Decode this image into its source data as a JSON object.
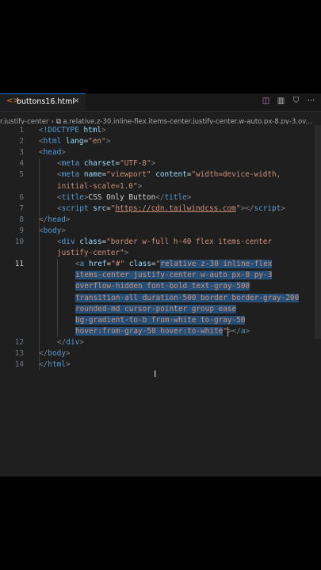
{
  "tab": {
    "icon": "code-icon",
    "name": "buttons16.html",
    "close": "×"
  },
  "breadcrumb": {
    "parent": "r.justify-center",
    "current": "a.relative.z-30.inline-flex.items-center.justify-center.w-auto.px-8.py-3.ov..."
  },
  "actions": [
    "split-compare-icon",
    "preview-icon",
    "lock-icon",
    "more-icon"
  ],
  "lines": [
    {
      "n": "1",
      "html": "<span class='br'>&lt;</span><span class='dt'>!DOCTYPE</span> <span class='at'>html</span><span class='br'>&gt;</span>",
      "indent": 0
    },
    {
      "n": "2",
      "html": "<span class='br'>&lt;</span><span class='tg'>html</span> <span class='at'>lang</span><span class='tx'>=</span><span class='st'>\"en\"</span><span class='br'>&gt;</span>",
      "indent": 0
    },
    {
      "n": "3",
      "html": "<span class='br'>&lt;</span><span class='tg'>head</span><span class='br'>&gt;</span>",
      "indent": 0
    },
    {
      "n": "4",
      "html": "<span class='br'>&lt;</span><span class='tg'>meta</span> <span class='at'>charset</span><span class='tx'>=</span><span class='st'>\"UTF-8\"</span><span class='br'>&gt;</span>",
      "indent": 1
    },
    {
      "n": "5",
      "html": "<span class='br'>&lt;</span><span class='tg'>meta</span> <span class='at'>name</span><span class='tx'>=</span><span class='st'>\"viewport\"</span> <span class='at'>content</span><span class='tx'>=</span><span class='st'>\"width=device-width,</span>",
      "indent": 1
    },
    {
      "n": "",
      "html": "<span class='st'>initial-scale=1.0\"</span><span class='br'>&gt;</span>",
      "indent": 1
    },
    {
      "n": "6",
      "html": "<span class='br'>&lt;</span><span class='tg'>title</span><span class='br'>&gt;</span><span class='tx'>CSS Only Button</span><span class='br'>&lt;/</span><span class='tg'>title</span><span class='br'>&gt;</span>",
      "indent": 1
    },
    {
      "n": "7",
      "html": "<span class='br'>&lt;</span><span class='tg'>script</span> <span class='at'>src</span><span class='tx'>=</span><span class='st'>\"</span><span class='ln'>https://cdn.tailwindcss.com</span><span class='st'>\"</span><span class='br'>&gt;&lt;/</span><span class='tg'>script</span><span class='br'>&gt;</span>",
      "indent": 1
    },
    {
      "n": "8",
      "html": "<span class='br'>&lt;/</span><span class='tg'>head</span><span class='br'>&gt;</span>",
      "indent": 0
    },
    {
      "n": "9",
      "html": "<span class='br'>&lt;</span><span class='tg'>body</span><span class='br'>&gt;</span>",
      "indent": 0
    },
    {
      "n": "10",
      "html": "<span class='br'>&lt;</span><span class='tg'>div</span> <span class='at'>class</span><span class='tx'>=</span><span class='st'>\"border w-full h-40 flex items-center</span>",
      "indent": 1
    },
    {
      "n": "",
      "html": "<span class='st'>justify-center\"</span><span class='br'>&gt;</span>",
      "indent": 1
    },
    {
      "n": "11",
      "html": "<span class='br'>&lt;</span><span class='tg'>a</span> <span class='at'>href</span><span class='tx'>=</span><span class='st'>\"#\"</span> <span class='at'>class</span><span class='tx'>=</span><span class='st'>\"<span class='sel'>relative z-30 inline-flex</span></span>",
      "indent": 2,
      "active": true
    },
    {
      "n": "",
      "html": "<span class='st sel'>items-center justify-center w-auto px-8 py-3</span>",
      "indent": 2,
      "selrow": true
    },
    {
      "n": "",
      "html": "<span class='st sel'>overflow-hidden font-bold text-gray-500</span>",
      "indent": 2,
      "selrow": true
    },
    {
      "n": "",
      "html": "<span class='st sel'>transition-all duration-500 border border-gray-200</span>",
      "indent": 2,
      "selrow": true
    },
    {
      "n": "",
      "html": "<span class='st sel'>rounded-md cursor-pointer group ease</span>",
      "indent": 2,
      "selrow": true
    },
    {
      "n": "",
      "html": "<span class='st sel'>bg-gradient-to-b from-white to-gray-50</span>",
      "indent": 2,
      "selrow": true
    },
    {
      "n": "",
      "html": "<span class='st'><span class='sel'>hover:from-gray-50 hover:to-white</span>\"</span><span class='br'>&gt;&lt;/</span><span class='tg'>a</span><span class='br'>&gt;</span>",
      "indent": 2,
      "selrow": true
    },
    {
      "n": "12",
      "html": "<span class='br'>&lt;/</span><span class='tg'>div</span><span class='br'>&gt;</span>",
      "indent": 1
    },
    {
      "n": "13",
      "html": "<span class='br'>&lt;/</span><span class='tg'>body</span><span class='br'>&gt;</span>",
      "indent": 0
    },
    {
      "n": "14",
      "html": "<span class='br'>&lt;/</span><span class='tg'>html</span><span class='br'>&gt;</span>",
      "indent": 0
    }
  ],
  "mouse_cursor": "I"
}
